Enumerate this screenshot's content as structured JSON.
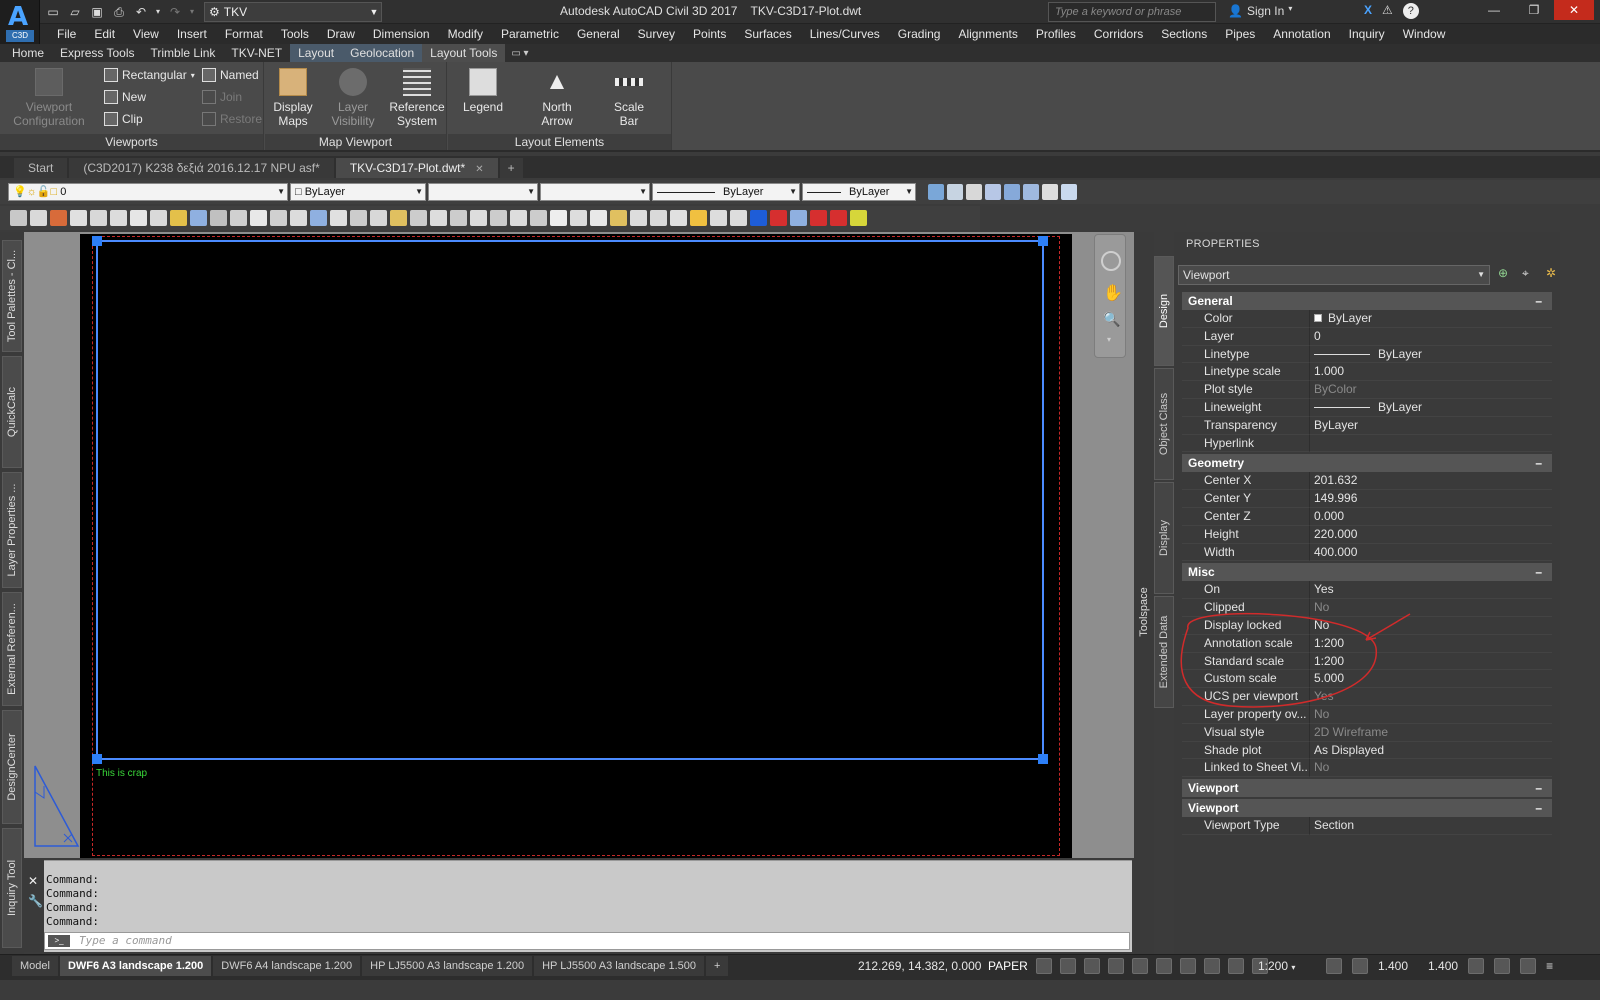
{
  "app": {
    "window_title": "Autodesk AutoCAD Civil 3D 2017    TKV-C3D17-Plot.dwt",
    "workspace": "TKV",
    "search_placeholder": "Type a keyword or phrase",
    "sign_in": "Sign In",
    "logo_text": "A",
    "logo_badge": "C3D"
  },
  "menu": [
    "File",
    "Edit",
    "View",
    "Insert",
    "Format",
    "Tools",
    "Draw",
    "Dimension",
    "Modify",
    "Parametric",
    "General",
    "Survey",
    "Points",
    "Surfaces",
    "Lines/Curves",
    "Grading",
    "Alignments",
    "Profiles",
    "Corridors",
    "Sections",
    "Pipes",
    "Annotation",
    "Inquiry",
    "Window"
  ],
  "ribbon_tabs": [
    "Home",
    "Express Tools",
    "Trimble Link",
    "TKV-NET",
    "Layout",
    "Geolocation",
    "Layout Tools"
  ],
  "ribbon": {
    "viewports": {
      "title": "Viewports",
      "config_label_1": "Viewport",
      "config_label_2": "Configuration",
      "rectangular": "Rectangular",
      "new": "New",
      "clip": "Clip",
      "named": "Named",
      "join": "Join",
      "restore": "Restore"
    },
    "map_viewport": {
      "title": "Map Viewport",
      "display_maps_1": "Display",
      "display_maps_2": "Maps",
      "layer_visibility_1": "Layer",
      "layer_visibility_2": "Visibility",
      "reference_system_1": "Reference",
      "reference_system_2": "System"
    },
    "layout_elements": {
      "title": "Layout Elements",
      "legend": "Legend",
      "north_arrow_1": "North",
      "north_arrow_2": "Arrow",
      "scale_bar_1": "Scale",
      "scale_bar_2": "Bar"
    }
  },
  "doc_tabs": [
    {
      "label": "Start"
    },
    {
      "label": "(C3D2017) K238 δεξιά 2016.12.17 NPU asf*"
    },
    {
      "label": "TKV-C3D17-Plot.dwt*"
    }
  ],
  "layer_toolbar": {
    "layer": "0",
    "color": "ByLayer",
    "linetype": "ByLayer",
    "lineweight": "ByLayer"
  },
  "left_palettes": [
    "Tool Palettes - Cl...",
    "QuickCalc",
    "Layer Properties ...",
    "External Referen...",
    "DesignCenter",
    "Inquiry Tool"
  ],
  "drawing": {
    "note_text": "This is crap"
  },
  "toolspace_label": "Toolspace",
  "properties": {
    "title": "PROPERTIES",
    "object": "Viewport",
    "tabs": [
      "Design",
      "Object Class",
      "Display",
      "Extended Data"
    ],
    "categories": {
      "general": {
        "title": "General",
        "rows": [
          {
            "k": "Color",
            "v": "ByLayer"
          },
          {
            "k": "Layer",
            "v": "0"
          },
          {
            "k": "Linetype",
            "v": "ByLayer"
          },
          {
            "k": "Linetype scale",
            "v": "1.000"
          },
          {
            "k": "Plot style",
            "v": "ByColor"
          },
          {
            "k": "Lineweight",
            "v": "ByLayer"
          },
          {
            "k": "Transparency",
            "v": "ByLayer"
          },
          {
            "k": "Hyperlink",
            "v": ""
          }
        ]
      },
      "geometry": {
        "title": "Geometry",
        "rows": [
          {
            "k": "Center X",
            "v": "201.632"
          },
          {
            "k": "Center Y",
            "v": "149.996"
          },
          {
            "k": "Center Z",
            "v": "0.000"
          },
          {
            "k": "Height",
            "v": "220.000"
          },
          {
            "k": "Width",
            "v": "400.000"
          }
        ]
      },
      "misc": {
        "title": "Misc",
        "rows": [
          {
            "k": "On",
            "v": "Yes"
          },
          {
            "k": "Clipped",
            "v": "No"
          },
          {
            "k": "Display locked",
            "v": "No"
          },
          {
            "k": "Annotation scale",
            "v": "1:200"
          },
          {
            "k": "Standard scale",
            "v": "1:200"
          },
          {
            "k": "Custom scale",
            "v": "5.000"
          },
          {
            "k": "UCS per viewport",
            "v": "Yes"
          },
          {
            "k": "Layer property ov...",
            "v": "No"
          },
          {
            "k": "Visual style",
            "v": "2D Wireframe"
          },
          {
            "k": "Shade plot",
            "v": "As Displayed"
          },
          {
            "k": "Linked to Sheet Vi...",
            "v": "No"
          }
        ]
      },
      "viewport1": {
        "title": "Viewport"
      },
      "viewport2": {
        "title": "Viewport",
        "rows": [
          {
            "k": "Viewport Type",
            "v": "Section"
          }
        ]
      }
    }
  },
  "command": {
    "history": [
      "Command:",
      "Command:",
      "Command:",
      "Command:"
    ],
    "placeholder": "Type a command"
  },
  "layout_tabs": [
    "Model",
    "DWF6 A3 landscape 1.200",
    "DWF6 A4 landscape 1.200",
    "HP LJ5500 A3 landscape 1.200",
    "HP LJ5500 A3 landscape 1.500"
  ],
  "status": {
    "coords": "212.269, 14.382, 0.000",
    "space": "PAPER",
    "scale": "1:200",
    "val1": "1.400",
    "val2": "1.400"
  },
  "colors": {
    "viewport_border": "#4b8bff",
    "annotation_red": "#d12b2b",
    "note_green": "#39d639"
  }
}
